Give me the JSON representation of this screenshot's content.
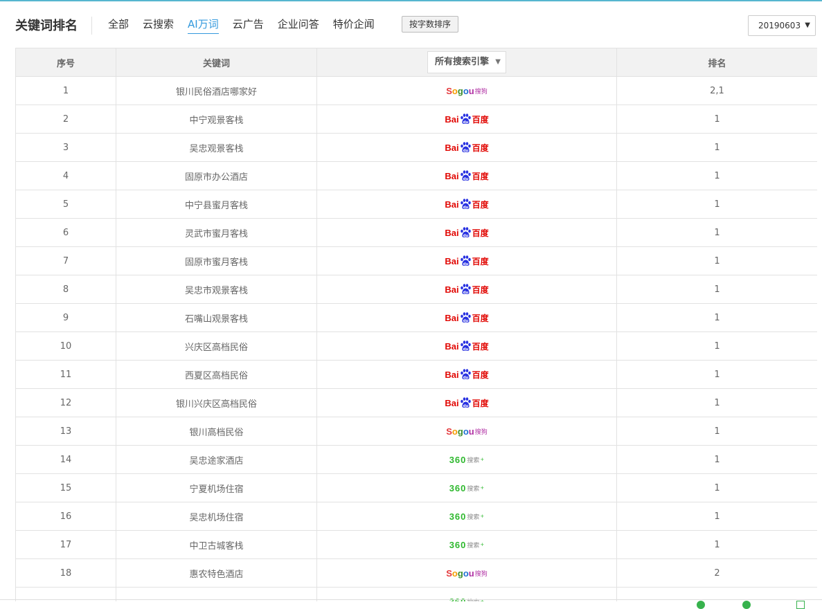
{
  "header": {
    "title": "关键词排名",
    "tabs": [
      {
        "label": "全部"
      },
      {
        "label": "云搜索"
      },
      {
        "label": "AI万词"
      },
      {
        "label": "云广告"
      },
      {
        "label": "企业问答"
      },
      {
        "label": "特价企闻"
      }
    ],
    "active_tab": "AI万词",
    "sort_button": "按字数排序",
    "date": "20190603",
    "accent_color": "#3399dd"
  },
  "table": {
    "columns": {
      "index": "序号",
      "keyword": "关键词",
      "engine_filter": "所有搜索引擎",
      "rank": "排名"
    },
    "rows": [
      {
        "index": "1",
        "keyword": "银川民俗酒店哪家好",
        "engine": "sogou-logo",
        "rank": "2,1"
      },
      {
        "index": "2",
        "keyword": "中宁观景客栈",
        "engine": "baidu-logo",
        "rank": "1"
      },
      {
        "index": "3",
        "keyword": "吴忠观景客栈",
        "engine": "baidu-logo",
        "rank": "1"
      },
      {
        "index": "4",
        "keyword": "固原市办公酒店",
        "engine": "baidu-logo",
        "rank": "1"
      },
      {
        "index": "5",
        "keyword": "中宁县蜜月客栈",
        "engine": "baidu-logo",
        "rank": "1"
      },
      {
        "index": "6",
        "keyword": "灵武市蜜月客栈",
        "engine": "baidu-logo",
        "rank": "1"
      },
      {
        "index": "7",
        "keyword": "固原市蜜月客栈",
        "engine": "baidu-logo",
        "rank": "1"
      },
      {
        "index": "8",
        "keyword": "吴忠市观景客栈",
        "engine": "baidu-logo",
        "rank": "1"
      },
      {
        "index": "9",
        "keyword": "石嘴山观景客栈",
        "engine": "baidu-logo",
        "rank": "1"
      },
      {
        "index": "10",
        "keyword": "兴庆区高档民俗",
        "engine": "baidu-logo",
        "rank": "1"
      },
      {
        "index": "11",
        "keyword": "西夏区高档民俗",
        "engine": "baidu-logo",
        "rank": "1"
      },
      {
        "index": "12",
        "keyword": "银川兴庆区高档民俗",
        "engine": "baidu-logo",
        "rank": "1"
      },
      {
        "index": "13",
        "keyword": "银川高档民俗",
        "engine": "sogou-logo",
        "rank": "1"
      },
      {
        "index": "14",
        "keyword": "吴忠途家酒店",
        "engine": "360-logo",
        "rank": "1"
      },
      {
        "index": "15",
        "keyword": "宁夏机场住宿",
        "engine": "360-logo",
        "rank": "1"
      },
      {
        "index": "16",
        "keyword": "吴忠机场住宿",
        "engine": "360-logo",
        "rank": "1"
      },
      {
        "index": "17",
        "keyword": "中卫古城客栈",
        "engine": "360-logo",
        "rank": "1"
      },
      {
        "index": "18",
        "keyword": "惠农特色酒店",
        "engine": "sogou-logo",
        "rank": "2"
      },
      {
        "index": "",
        "keyword": "",
        "engine": "360-logo",
        "rank": ""
      }
    ]
  },
  "logos": {
    "baidu": {
      "text_left": "Bai",
      "text_right": "百度"
    },
    "sogou": {
      "text_left": "Sogou",
      "text_right": "搜狗"
    },
    "so360": {
      "text_left": "360",
      "text_right": "搜索"
    }
  }
}
